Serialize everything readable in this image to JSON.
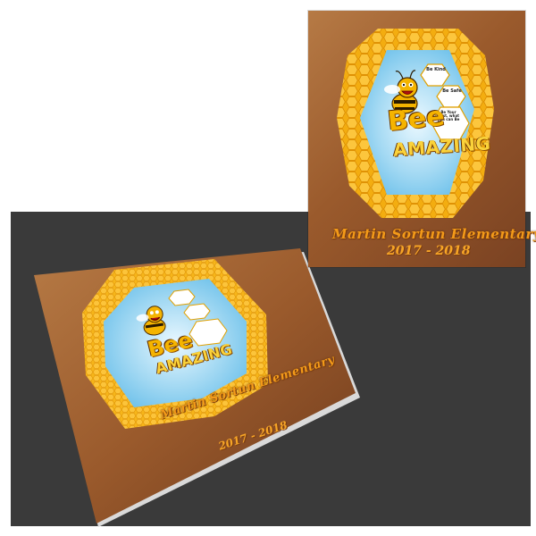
{
  "front_cover": {
    "school_name": "Martin Sortun Elementary",
    "years": "2017 - 2018",
    "logo_word_1": "Bee",
    "logo_word_2": "AMAZING",
    "hex_1": "Be Kind",
    "hex_2": "Be Safe",
    "hex_3": "Be Your Best, what you can Be"
  },
  "mockup_cover": {
    "school_name": "Martin Sortun Elementary",
    "years": "2017 - 2018",
    "logo_word_1": "Bee",
    "logo_word_2": "AMAZING",
    "hex_1": "Be Kind",
    "hex_2": "Be Safe",
    "hex_3": "Be Your Best, what you can Be"
  },
  "colors": {
    "background_dark": "#3a3a3a",
    "cover_brown": "#9a5a2c",
    "honey": "#f5b400",
    "sky": "#8fd0ef",
    "title_orange": "#f39a19"
  }
}
